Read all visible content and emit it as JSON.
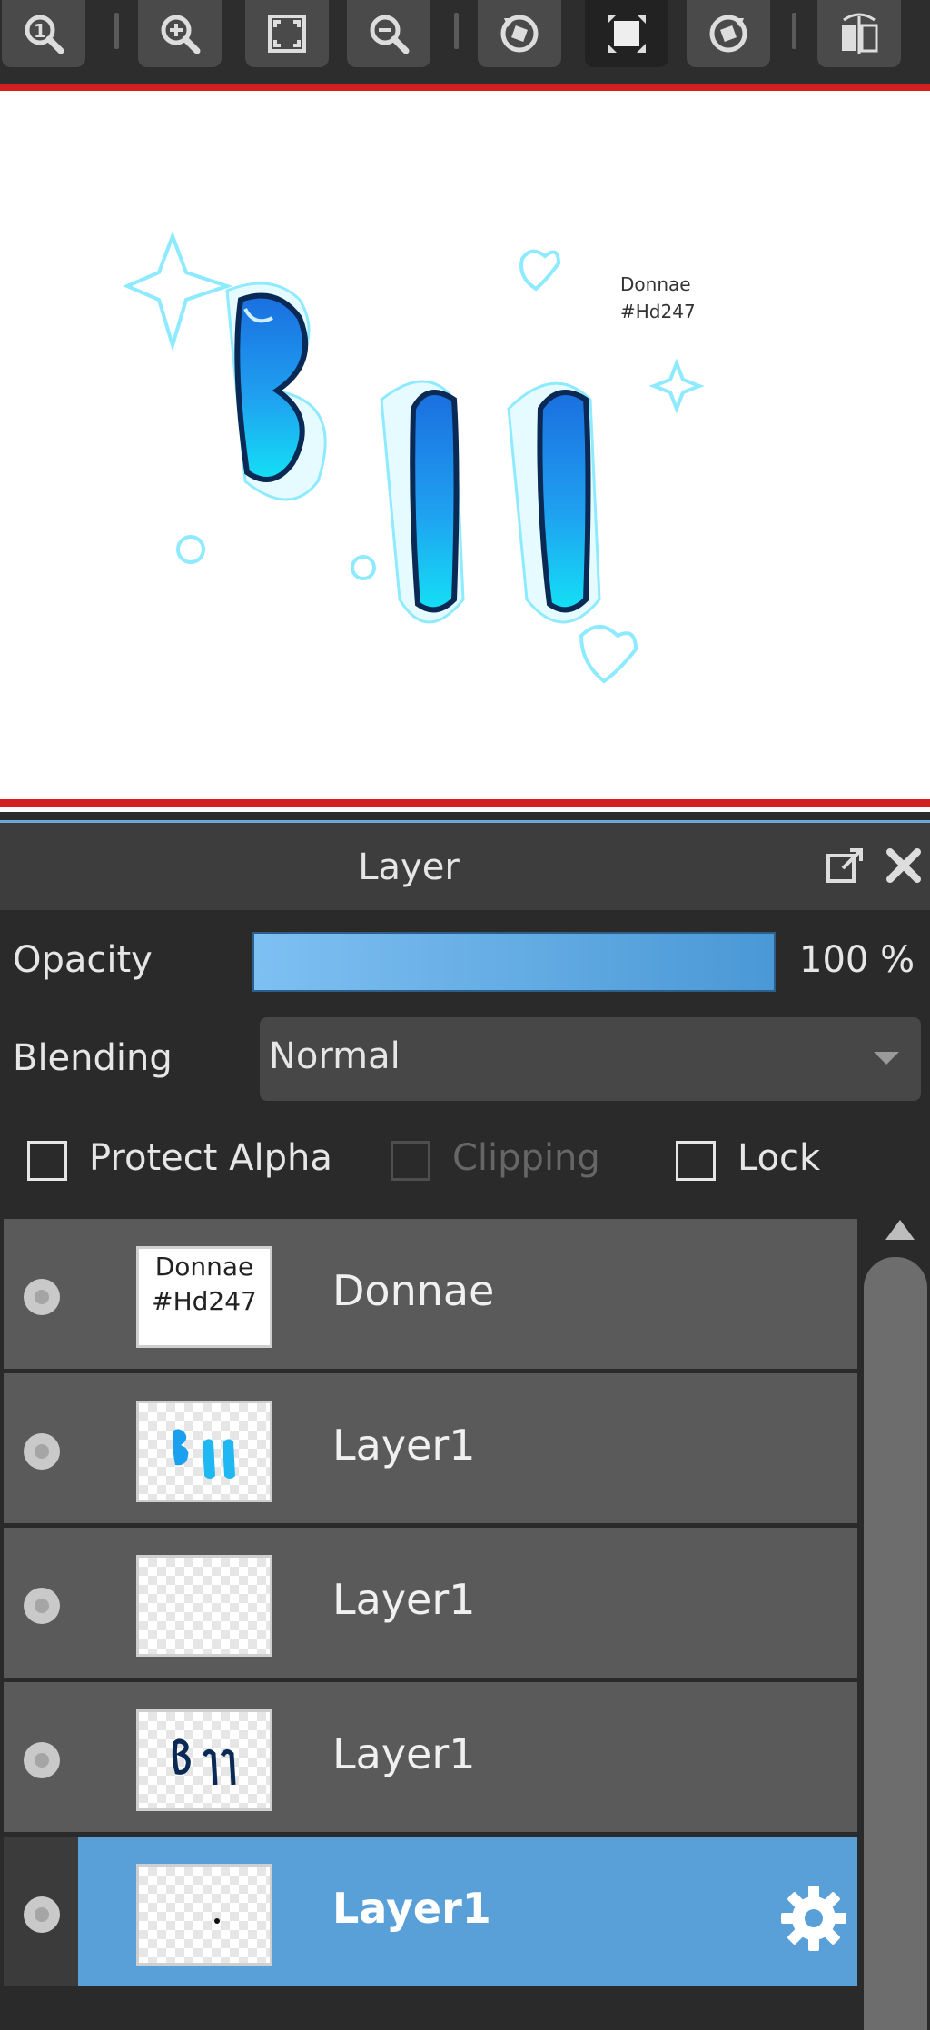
{
  "toolbar": {
    "buttons": [
      {
        "name": "zoom-actual-size-icon"
      },
      {
        "name": "zoom-in-icon"
      },
      {
        "name": "fit-to-screen-icon"
      },
      {
        "name": "zoom-out-icon"
      },
      {
        "name": "rotate-left-icon"
      },
      {
        "name": "reset-view-icon"
      },
      {
        "name": "rotate-right-icon"
      },
      {
        "name": "flip-horizontal-icon"
      }
    ]
  },
  "canvas": {
    "caption_line1": "Donnae",
    "caption_line2": "#Hd247"
  },
  "panel": {
    "title": "Layer",
    "opacity_label": "Opacity",
    "opacity_percent": 100,
    "opacity_value": "100 %",
    "blending_label": "Blending",
    "blending_value": "Normal",
    "protect_alpha_label": "Protect Alpha",
    "clipping_label": "Clipping",
    "lock_label": "Lock",
    "protect_alpha_checked": false,
    "clipping_checked": false,
    "clipping_enabled": false,
    "lock_checked": false
  },
  "layers": [
    {
      "name": "Donnae",
      "thumb_line1": "Donnae",
      "thumb_line2": "#Hd247",
      "selected": false
    },
    {
      "name": "Layer1",
      "selected": false
    },
    {
      "name": "Layer1",
      "selected": false
    },
    {
      "name": "Layer1",
      "selected": false
    },
    {
      "name": "Layer1",
      "selected": true
    }
  ],
  "colors": {
    "accent": "#5aa0d8",
    "canvas_border": "#d21f1f",
    "lettering_blue": "#1e86e8",
    "lettering_cyan": "#14d3f0"
  }
}
